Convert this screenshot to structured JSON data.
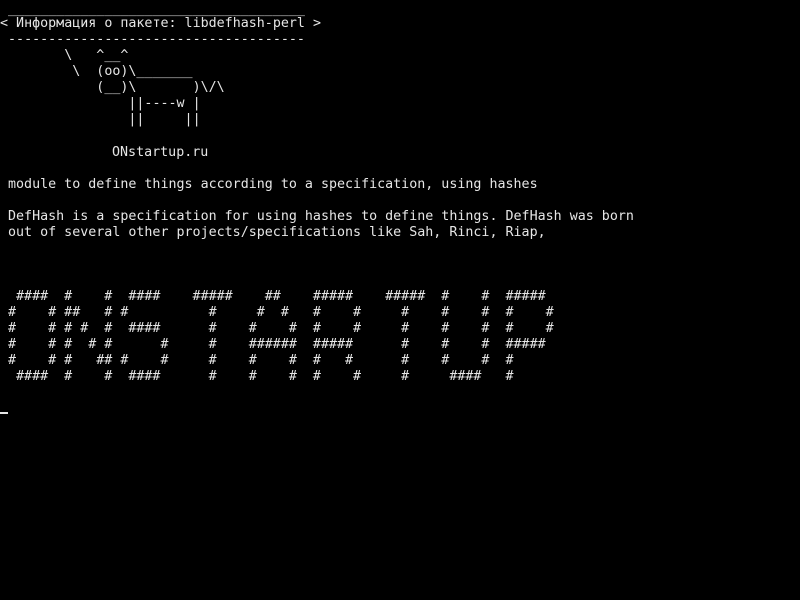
{
  "screen": {
    "background": "#000000",
    "foreground": "#e6e6e6"
  },
  "cowsay": {
    "border_top": " _____________________________________",
    "message": "< Информация о пакете: libdefhash-perl >",
    "border_bottom": " -------------------------------------",
    "cow": [
      "        \\   ^__^",
      "         \\  (oo)\\_______",
      "            (__)\\       )\\/\\",
      "                ||----w |",
      "                ||     ||"
    ]
  },
  "site_label": "ONstartup.ru",
  "package": {
    "summary": "module to define things according to a specification, using hashes",
    "description": [
      "DefHash is a specification for using hashes to define things. DefHash was born",
      "out of several other projects/specifications like Sah, Rinci, Riap,"
    ]
  },
  "banner": [
    " ####  #    #  ####    #####    ##    #####    #####  #    #  #####",
    "#    # ##   # #          #     #  #   #    #     #    #    #  #    #",
    "#    # # #  #  ####      #    #    #  #    #     #    #    #  #    #",
    "#    # #  # #      #     #    ######  #####      #    #    #  #####",
    "#    # #   ## #    #     #    #    #  #   #      #    #    #  #",
    " ####  #    #  ####      #    #    #  #    #     #     ####   #"
  ]
}
